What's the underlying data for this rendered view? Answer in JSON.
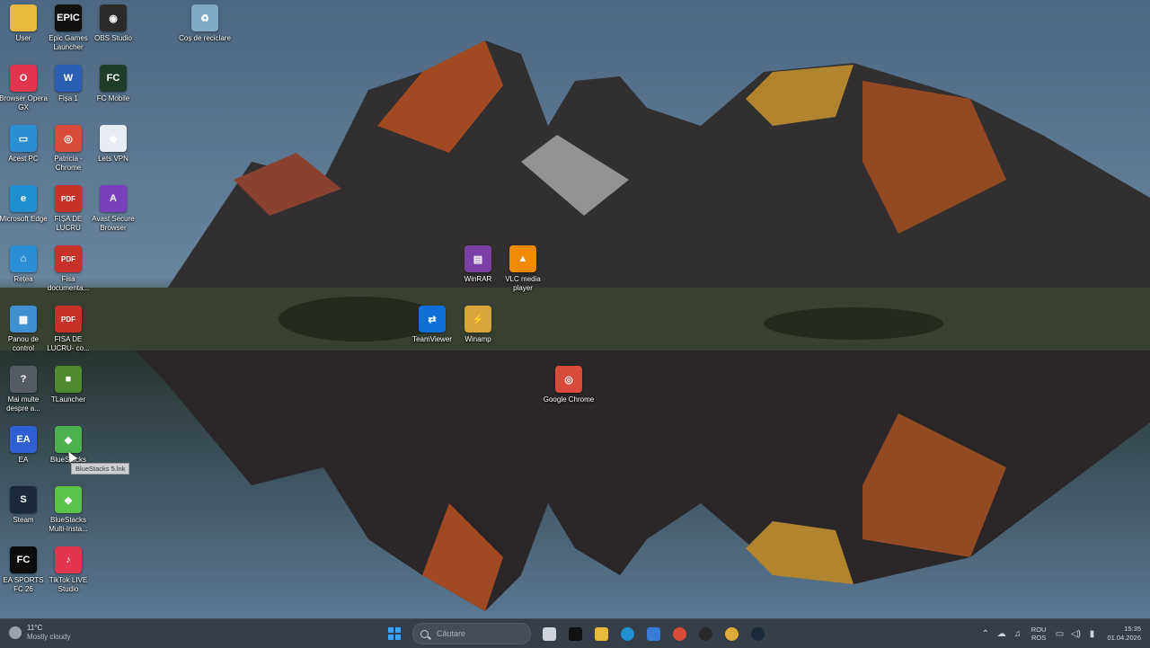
{
  "desktop": {
    "icons": [
      {
        "label": "User",
        "icon": "folder-icon",
        "color": "#e8b93a",
        "glyph": ""
      },
      {
        "label": "Epic Games Launcher",
        "icon": "epic-games-icon",
        "color": "#111111",
        "glyph": "EPIC"
      },
      {
        "label": "OBS Studio",
        "icon": "obs-icon",
        "color": "#2a2a2a",
        "glyph": "◉"
      },
      {
        "label": "Coș de reciclare",
        "icon": "recycle-bin-icon",
        "color": "#7fa9c4",
        "glyph": "♻"
      },
      {
        "label": "Browser Opera GX",
        "icon": "opera-icon",
        "color": "#e0344f",
        "glyph": "O"
      },
      {
        "label": "Fișa 1",
        "icon": "word-doc-icon",
        "color": "#2b5fb3",
        "glyph": "W"
      },
      {
        "label": "FC Mobile",
        "icon": "fc-mobile-icon",
        "color": "#1f3d2b",
        "glyph": "FC"
      },
      {
        "label": "Acest PC",
        "icon": "this-pc-icon",
        "color": "#2b8fd6",
        "glyph": "▭"
      },
      {
        "label": "Patricia - Chrome",
        "icon": "chrome-icon",
        "color": "#d94a3a",
        "glyph": "◎"
      },
      {
        "label": "Lets VPN",
        "icon": "vpn-icon",
        "color": "#e6ecf2",
        "glyph": "◆"
      },
      {
        "label": "Microsoft Edge",
        "icon": "edge-icon",
        "color": "#1f8fcf",
        "glyph": "e"
      },
      {
        "label": "FIȘA DE LUCRU",
        "icon": "pdf-icon",
        "color": "#c8312a",
        "glyph": "PDF"
      },
      {
        "label": "Avast Secure Browser",
        "icon": "avast-icon",
        "color": "#7a3fbf",
        "glyph": "A"
      },
      {
        "label": "Rețea",
        "icon": "network-icon",
        "color": "#2b8fd6",
        "glyph": "⌂"
      },
      {
        "label": "Fisa documenta...",
        "icon": "pdf-icon",
        "color": "#c8312a",
        "glyph": "PDF"
      },
      {
        "label": "Panou de control",
        "icon": "control-panel-icon",
        "color": "#3f8fd1",
        "glyph": "▦"
      },
      {
        "label": "FISA DE LUCRU- co...",
        "icon": "pdf-icon",
        "color": "#c8312a",
        "glyph": "PDF"
      },
      {
        "label": "Mai multe despre a...",
        "icon": "info-icon",
        "color": "#555b63",
        "glyph": "?"
      },
      {
        "label": "TLauncher",
        "icon": "tlauncher-icon",
        "color": "#4f8b2e",
        "glyph": "■"
      },
      {
        "label": "EA",
        "icon": "ea-icon",
        "color": "#2f5fd1",
        "glyph": "EA"
      },
      {
        "label": "BlueStacks",
        "icon": "bluestacks-icon",
        "color": "#4caf50",
        "glyph": "◆"
      },
      {
        "label": "Steam",
        "icon": "steam-icon",
        "color": "#1b2a3a",
        "glyph": "S"
      },
      {
        "label": "BlueStacks Multi-Insta...",
        "icon": "bluestacks-multi-icon",
        "color": "#5cc34a",
        "glyph": "◆"
      },
      {
        "label": "EA SPORTS FC 26",
        "icon": "ea-fc-icon",
        "color": "#0d0d0d",
        "glyph": "FC"
      },
      {
        "label": "TikTok LIVE Studio",
        "icon": "tiktok-icon",
        "color": "#e0344f",
        "glyph": "♪"
      },
      {
        "label": "WinRAR",
        "icon": "winrar-icon",
        "color": "#7b3fa8",
        "glyph": "▤"
      },
      {
        "label": "VLC media player",
        "icon": "vlc-icon",
        "color": "#f08a00",
        "glyph": "▲"
      },
      {
        "label": "TeamViewer",
        "icon": "teamviewer-icon",
        "color": "#0e6fd8",
        "glyph": "⇄"
      },
      {
        "label": "Winamp",
        "icon": "winamp-icon",
        "color": "#d9a43a",
        "glyph": "⚡"
      },
      {
        "label": "Google Chrome",
        "icon": "chrome-icon",
        "color": "#d94a3a",
        "glyph": "◎"
      }
    ],
    "tooltip": "BlueStacks 5.lnk"
  },
  "taskbar": {
    "weather": {
      "temp": "11°C",
      "condition": "Mostly cloudy"
    },
    "search_placeholder": "Căutare",
    "apps": [
      {
        "name": "task-view-icon",
        "color": "#cfd4da"
      },
      {
        "name": "capcut-icon",
        "color": "#111111"
      },
      {
        "name": "file-explorer-icon",
        "color": "#e8b93a"
      },
      {
        "name": "edge-icon",
        "color": "#1f8fcf"
      },
      {
        "name": "store-icon",
        "color": "#3a7bd5"
      },
      {
        "name": "chrome-icon",
        "color": "#d94a3a"
      },
      {
        "name": "obs-icon",
        "color": "#2a2a2a"
      },
      {
        "name": "chrome-profile-icon",
        "color": "#e0a93a"
      },
      {
        "name": "steam-icon",
        "color": "#1b2a3a"
      }
    ],
    "language": {
      "line1": "ROU",
      "line2": "ROS"
    },
    "time": "15:35",
    "date": "01.04.2026"
  }
}
